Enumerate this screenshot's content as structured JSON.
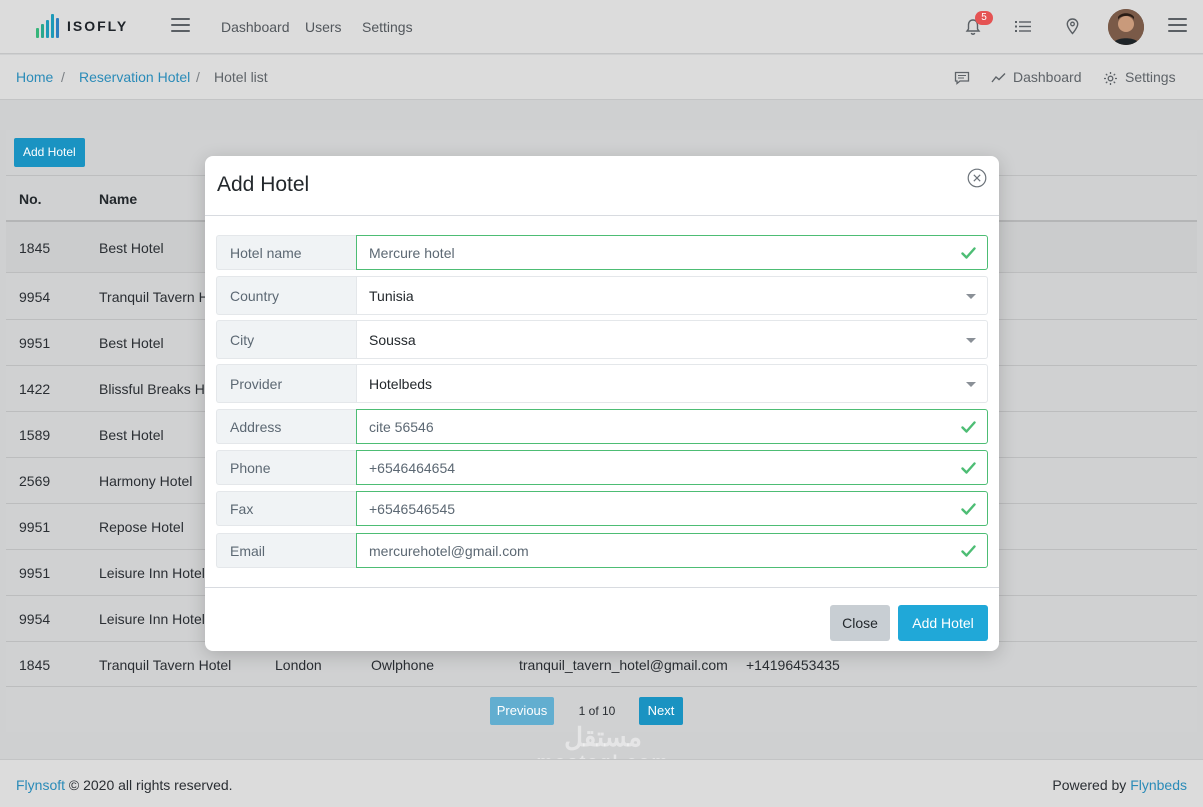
{
  "header": {
    "logo_text": "ISOFLY",
    "nav": [
      "Dashboard",
      "Users",
      "Settings"
    ],
    "notification_count": "5",
    "icons": [
      "hamburger-icon",
      "bell-icon",
      "list-icon",
      "location-pin-icon",
      "avatar",
      "hamburger-icon"
    ]
  },
  "breadcrumb": {
    "items": [
      "Home",
      "Reservation Hotel",
      "Hotel list"
    ],
    "separator": "/"
  },
  "subnav": {
    "dashboard": "Dashboard",
    "settings": "Settings"
  },
  "table": {
    "add_button": "Add Hotel",
    "columns": [
      "No.",
      "Name"
    ],
    "rows": [
      {
        "no": "1845",
        "name": "Best Hotel",
        "city": "",
        "provider": "",
        "email": "",
        "phone": ""
      },
      {
        "no": "9954",
        "name": "Tranquil Tavern H",
        "city": "",
        "provider": "",
        "email": "",
        "phone": ""
      },
      {
        "no": "9951",
        "name": "Best Hotel",
        "city": "",
        "provider": "",
        "email": "",
        "phone": ""
      },
      {
        "no": "1422",
        "name": "Blissful Breaks Ho",
        "city": "",
        "provider": "",
        "email": "",
        "phone": ""
      },
      {
        "no": "1589",
        "name": "Best Hotel",
        "city": "",
        "provider": "",
        "email": "",
        "phone": ""
      },
      {
        "no": "2569",
        "name": "Harmony Hotel",
        "city": "",
        "provider": "",
        "email": "",
        "phone": ""
      },
      {
        "no": "9951",
        "name": "Repose Hotel",
        "city": "",
        "provider": "",
        "email": "",
        "phone": ""
      },
      {
        "no": "9951",
        "name": "Leisure Inn Hotel",
        "city": "",
        "provider": "",
        "email": "",
        "phone": ""
      },
      {
        "no": "9954",
        "name": "Leisure Inn Hotel",
        "city": "",
        "provider": "",
        "email": "",
        "phone": ""
      },
      {
        "no": "1845",
        "name": "Tranquil Tavern Hotel",
        "city": "London",
        "provider": "Owlphone",
        "email": "tranquil_tavern_hotel@gmail.com",
        "phone": "+14196453435"
      }
    ]
  },
  "pagination": {
    "previous": "Previous",
    "page_info": "1 of 10",
    "next": "Next"
  },
  "footer": {
    "brand": "Flynsoft",
    "copyright": "© 2020 all rights reserved.",
    "powered_by": "Powered by",
    "powered_brand": "Flynbeds"
  },
  "modal": {
    "title": "Add Hotel",
    "fields": [
      {
        "label": "Hotel name",
        "value": "Mercure hotel",
        "type": "text",
        "valid": true
      },
      {
        "label": "Country",
        "value": "Tunisia",
        "type": "select",
        "valid": false
      },
      {
        "label": "City",
        "value": "Soussa",
        "type": "select",
        "valid": false
      },
      {
        "label": "Provider",
        "value": "Hotelbeds",
        "type": "select",
        "valid": false
      },
      {
        "label": "Address",
        "value": "cite 56546",
        "type": "text",
        "valid": true
      },
      {
        "label": "Phone",
        "value": "+6546464654",
        "type": "text",
        "valid": true
      },
      {
        "label": "Fax",
        "value": "+6546546545",
        "type": "text",
        "valid": true
      },
      {
        "label": "Email",
        "value": "mercurehotel@gmail.com",
        "type": "text",
        "valid": true
      }
    ],
    "close_label": "Close",
    "submit_label": "Add Hotel"
  },
  "watermark": {
    "arabic": "مستقل",
    "latin": "mostaql.com"
  },
  "colors": {
    "accent": "#20a8d8",
    "valid": "#4dbd74",
    "badge": "#e55353"
  }
}
